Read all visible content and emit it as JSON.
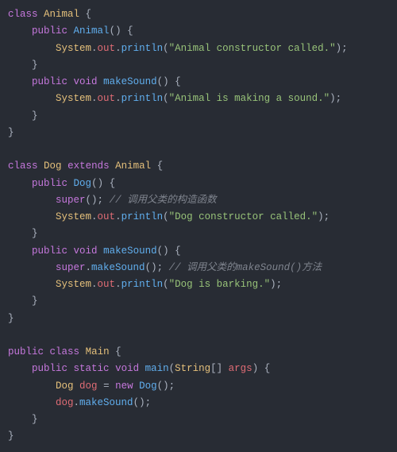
{
  "code": {
    "l1": {
      "kw_class": "class",
      "cls": "Animal",
      "brace": " {"
    },
    "l2": {
      "kw_pub": "public",
      "fn": "Animal",
      "paren": "() {"
    },
    "l3": {
      "sys": "System",
      "out": "out",
      "fn": "println",
      "str": "\"Animal constructor called.\"",
      "end": ";"
    },
    "l4": {
      "brace": "}"
    },
    "l5": {
      "kw_pub": "public",
      "kw_void": "void",
      "fn": "makeSound",
      "paren": "() {"
    },
    "l6": {
      "sys": "System",
      "out": "out",
      "fn": "println",
      "str": "\"Animal is making a sound.\"",
      "end": ";"
    },
    "l7": {
      "brace": "}"
    },
    "l8": {
      "brace": "}"
    },
    "l9": {
      "kw_class": "class",
      "cls": "Dog",
      "kw_ext": "extends",
      "sup": "Animal",
      "brace": " {"
    },
    "l10": {
      "kw_pub": "public",
      "fn": "Dog",
      "paren": "() {"
    },
    "l11": {
      "kw_super": "super",
      "paren": "();",
      "cmt": "// 调用父类的构造函数"
    },
    "l12": {
      "sys": "System",
      "out": "out",
      "fn": "println",
      "str": "\"Dog constructor called.\"",
      "end": ";"
    },
    "l13": {
      "brace": "}"
    },
    "l14": {
      "kw_pub": "public",
      "kw_void": "void",
      "fn": "makeSound",
      "paren": "() {"
    },
    "l15": {
      "kw_super": "super",
      "fn": "makeSound",
      "paren": "();",
      "cmt": "// 调用父类的makeSound()方法"
    },
    "l16": {
      "sys": "System",
      "out": "out",
      "fn": "println",
      "str": "\"Dog is barking.\"",
      "end": ";"
    },
    "l17": {
      "brace": "}"
    },
    "l18": {
      "brace": "}"
    },
    "l19": {
      "kw_pub": "public",
      "kw_class": "class",
      "cls": "Main",
      "brace": " {"
    },
    "l20": {
      "kw_pub": "public",
      "kw_static": "static",
      "kw_void": "void",
      "fn": "main",
      "p1": "(",
      "ty": "String",
      "arr": "[] ",
      "arg": "args",
      "p2": ") {"
    },
    "l21": {
      "ty": "Dog",
      "var": "dog",
      "eq": " = ",
      "kw_new": "new",
      "fn": "Dog",
      "paren": "();"
    },
    "l22": {
      "var": "dog",
      "fn": "makeSound",
      "paren": "();"
    },
    "l23": {
      "brace": "}"
    },
    "l24": {
      "brace": "}"
    }
  }
}
